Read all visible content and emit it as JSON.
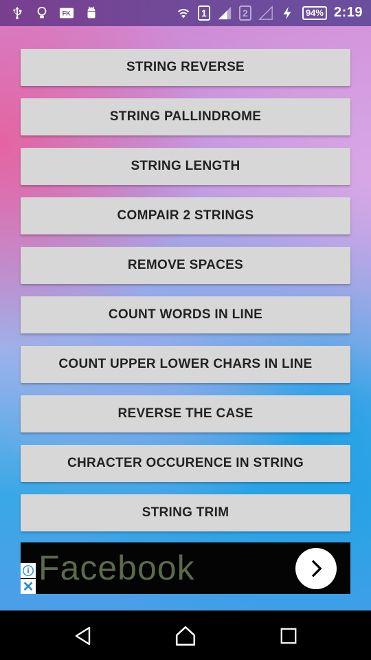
{
  "status_bar": {
    "icons_left": [
      "usb-icon",
      "lightbulb-icon",
      "fk-app-icon",
      "android-icon"
    ],
    "sim1": "1",
    "sim2": "2",
    "battery": "94%",
    "time": "2:19"
  },
  "buttons": [
    "STRING REVERSE",
    "STRING PALLINDROME",
    "STRING LENGTH",
    "COMPAIR 2 STRINGS",
    "REMOVE SPACES",
    "COUNT WORDS IN LINE",
    "COUNT UPPER LOWER CHARS IN LINE",
    "REVERSE THE CASE",
    "CHRACTER OCCURENCE IN STRING",
    "STRING TRIM"
  ],
  "ad": {
    "title": "Facebook",
    "close": "✕"
  },
  "colors": {
    "button_bg": "#d7d7d7",
    "statusbar": "#6f4b99",
    "navbar": "#000000"
  }
}
